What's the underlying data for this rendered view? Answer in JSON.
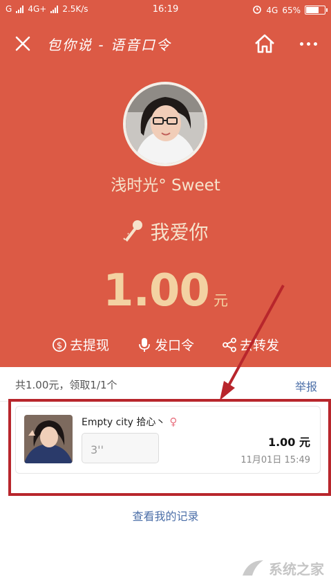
{
  "status_bar": {
    "carrier_g": "G",
    "network": "4G+",
    "speed": "2.5K/s",
    "time": "16:19",
    "network_right": "4G",
    "battery": "65%",
    "battery_level": 0.65
  },
  "nav": {
    "title": "包你说 - 语音口令",
    "close_icon": "close-icon",
    "home_icon": "home-icon",
    "more_icon": "more-icon"
  },
  "profile": {
    "username": "浅时光° Sweet"
  },
  "packet": {
    "phrase": "我爱你",
    "amount": "1.00",
    "unit": "元"
  },
  "actions": [
    {
      "label": "去提现",
      "icon": "dollar-circle-icon"
    },
    {
      "label": "发口令",
      "icon": "microphone-icon"
    },
    {
      "label": "去转发",
      "icon": "share-icon"
    }
  ],
  "summary": {
    "text": "共1.00元，领取1/1个",
    "report": "举报"
  },
  "record": {
    "name": "Empty city 拾心丶",
    "gender_symbol": "♀",
    "voice_duration": "3''",
    "amount": "1.00 元",
    "time": "11月01日 15:49"
  },
  "footer": {
    "link": "查看我的记录"
  },
  "watermark": {
    "text": "系统之家"
  },
  "colors": {
    "header_bg": "#dc5a45",
    "accent_gold": "#f3d2a2",
    "link_blue": "#4c6fa8",
    "highlight_red": "#b8262c"
  }
}
